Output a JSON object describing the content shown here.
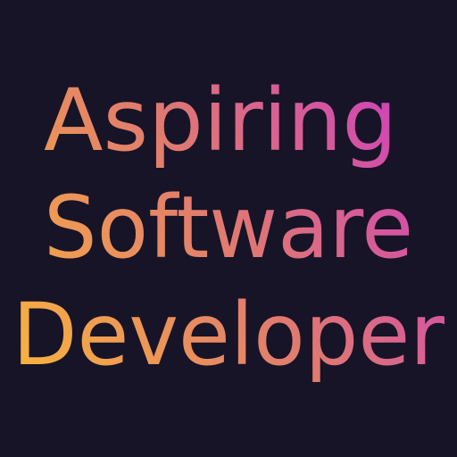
{
  "headline": {
    "lines": [
      "Aspiring",
      "Software",
      "Developer"
    ]
  },
  "colors": {
    "background": "#171427",
    "gradient_start": "#F8B33E",
    "gradient_mid": "#E07A70",
    "gradient_end": "#CC3BC3"
  }
}
